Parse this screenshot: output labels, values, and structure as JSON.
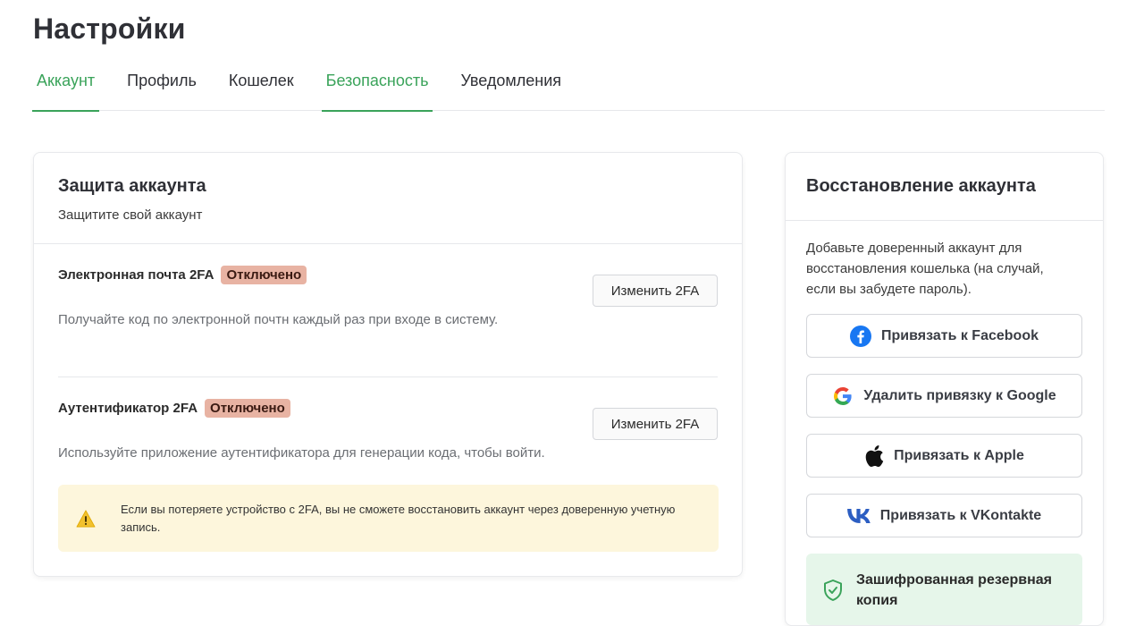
{
  "page": {
    "title": "Настройки"
  },
  "tabs": [
    {
      "label": "Аккаунт",
      "active": true
    },
    {
      "label": "Профиль",
      "active": false
    },
    {
      "label": "Кошелек",
      "active": false
    },
    {
      "label": "Безопасность",
      "active": true
    },
    {
      "label": "Уведомления",
      "active": false
    }
  ],
  "protection": {
    "title": "Защита аккаунта",
    "subtitle": "Защитите свой аккаунт",
    "email_2fa": {
      "label": "Электронная почта 2FA",
      "status": "Отключено",
      "button": "Изменить 2FA",
      "description": "Получайте код по электронной почтн каждый раз при входе в систему."
    },
    "auth_2fa": {
      "label": "Аутентификатор 2FA",
      "status": "Отключено",
      "button": "Изменить 2FA",
      "description": "Используйте приложение аутентификатора для генерации кода, чтобы войти."
    },
    "warning": {
      "icon": "warning-icon",
      "line1": "Если вы потеряете устройство с 2FA, вы не сможете восстановить аккаунт через доверенную учетную",
      "line2": "запись."
    }
  },
  "recovery": {
    "title": "Восстановление аккаунта",
    "description_lines": [
      "Добавьте доверенный аккаунт для",
      "восстановления кошелька (на случай,",
      "если вы забудете пароль)."
    ],
    "buttons": {
      "facebook": {
        "label": "Привязать к Facebook",
        "icon": "facebook-icon"
      },
      "google": {
        "label": "Удалить привязку к Google",
        "icon": "google-icon"
      },
      "apple": {
        "label": "Привязать к Apple",
        "icon": "apple-icon"
      },
      "vk": {
        "label": "Привязать к VKontakte",
        "icon": "vk-icon"
      }
    },
    "backup": {
      "line1": "Зашифрованная резервная",
      "line2": "копия",
      "icon": "shield-check-icon"
    }
  },
  "colors": {
    "accent": "#3aa35a",
    "badge_bg": "#e8b3a3",
    "warning_bg": "#fdf6dc",
    "backup_bg": "#e6f6ea"
  }
}
